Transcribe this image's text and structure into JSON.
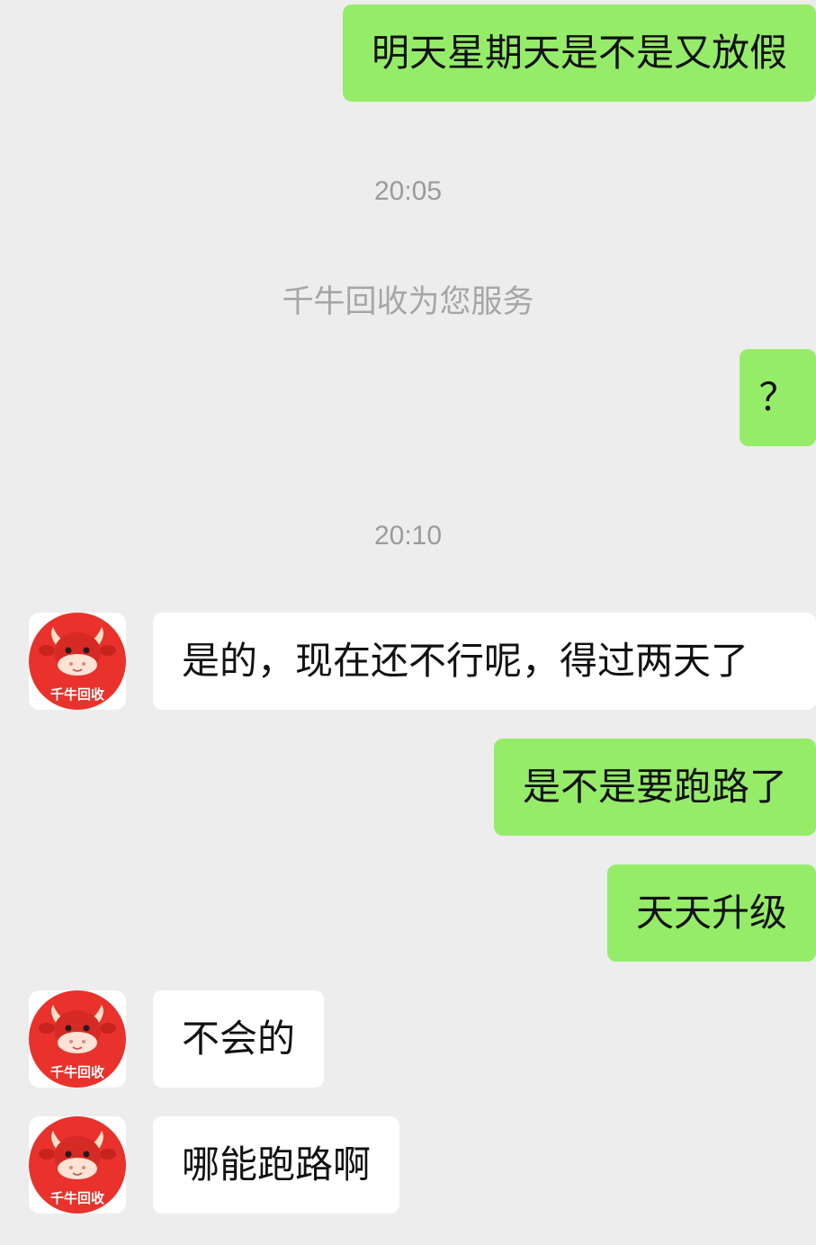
{
  "messages": [
    {
      "text": "明天星期天是不是又放假"
    },
    {
      "time": "20:05"
    },
    {
      "system": "千牛回收为您服务"
    },
    {
      "text": "？"
    },
    {
      "time": "20:10"
    },
    {
      "text": "是的，现在还不行呢，得过两天了"
    },
    {
      "text": "是不是要跑路了"
    },
    {
      "text": "天天升级"
    },
    {
      "text": "不会的"
    },
    {
      "text": "哪能跑路啊"
    }
  ],
  "agent": {
    "avatar_label": "千牛回收",
    "avatar_icon": "cartoon-bull-icon"
  },
  "colors": {
    "background": "#ededed",
    "outgoing_bubble": "#95ec69",
    "incoming_bubble": "#ffffff",
    "brand_red": "#e8322b"
  }
}
